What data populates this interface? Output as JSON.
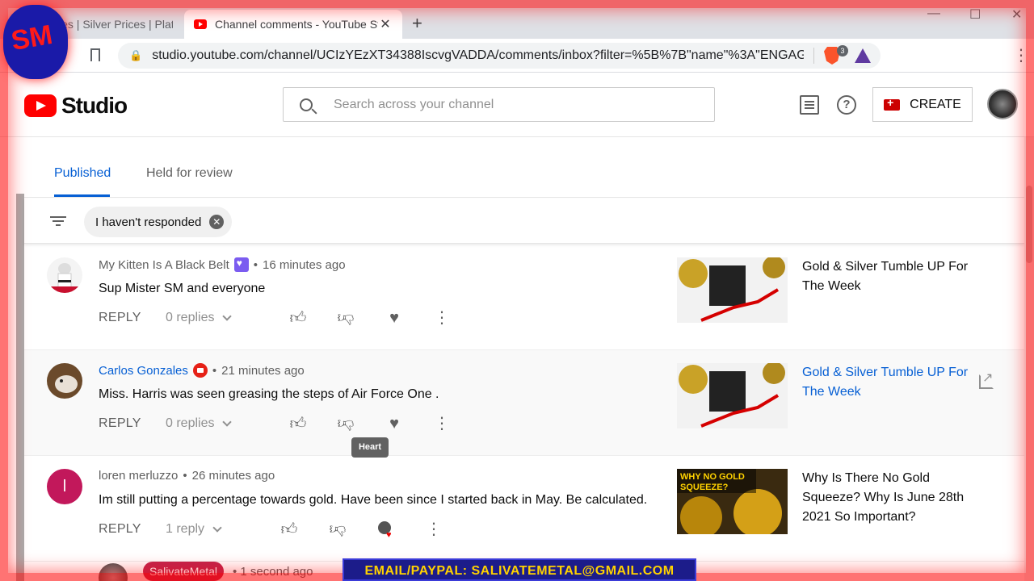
{
  "browser": {
    "tabs": [
      {
        "title": "Prices | Silver Prices | Platinum",
        "active": false
      },
      {
        "title": "Channel comments - YouTube Studio",
        "active": true
      }
    ],
    "new_tab": "+",
    "url": "studio.youtube.com/channel/UCIzYEzXT34388IscvgVADDA/comments/inbox?filter=%5B%7B\"name\"%3A\"ENGAG...",
    "brave_badge": "3"
  },
  "header": {
    "logo_text": "Studio",
    "search_placeholder": "Search across your channel",
    "create_label": "CREATE"
  },
  "tabs": [
    {
      "label": "Published",
      "active": true
    },
    {
      "label": "Held for review",
      "active": false
    }
  ],
  "filter": {
    "chip_label": "I haven't responded"
  },
  "comments": [
    {
      "author": "My Kitten Is A Black Belt",
      "time": "16 minutes ago",
      "text": "Sup Mister SM and everyone",
      "reply_label": "REPLY",
      "replies": "0 replies",
      "video_title": "Gold & Silver Tumble UP For The Week"
    },
    {
      "author": "Carlos Gonzales",
      "time": "21 minutes ago",
      "text": "Miss. Harris was seen greasing the steps of Air Force One .",
      "reply_label": "REPLY",
      "replies": "0 replies",
      "video_title": "Gold & Silver Tumble UP For The Week"
    },
    {
      "author": "loren merluzzo",
      "avatar_letter": "l",
      "time": "26 minutes ago",
      "text": "Im still putting a percentage towards gold. Have been since I started back in May. Be calculated.",
      "reply_label": "REPLY",
      "replies": "1 reply",
      "video_title": "Why Is There No Gold Squeeze? Why Is June 28th 2021 So Important?",
      "thumb_text": "WHY NO GOLD SQUEEZE?"
    }
  ],
  "tooltip": "Heart",
  "reply_row": {
    "author": "SalivateMetal",
    "time": "1 second ago"
  },
  "overlay": {
    "banner": "EMAIL/PAYPAL: SALIVATEMETAL@GMAIL.COM"
  },
  "colors": {
    "accent": "#065fd4",
    "brand_red": "#ff0000",
    "owner_chip": "#c0254d",
    "banner_text": "#ffd200"
  }
}
